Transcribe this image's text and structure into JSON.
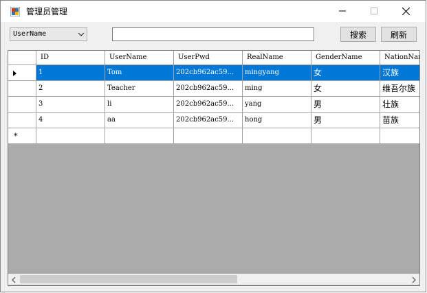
{
  "window": {
    "title": "管理员管理",
    "controls": [
      "minimize",
      "maximize",
      "close"
    ]
  },
  "toolbar": {
    "field_select": {
      "selected": "UserName"
    },
    "search_input": {
      "value": ""
    },
    "search_button_label": "搜索",
    "refresh_button_label": "刷新"
  },
  "grid": {
    "columns": [
      "ID",
      "UserName",
      "UserPwd",
      "RealName",
      "GenderName",
      "NationNam"
    ],
    "rows": [
      [
        "1",
        "Tom",
        "202cb962ac59...",
        "mingyang",
        "女",
        "汉族"
      ],
      [
        "2",
        "Teacher",
        "202cb962ac59...",
        "ming",
        "女",
        "维吾尔族"
      ],
      [
        "3",
        "li",
        "202cb962ac59...",
        "yang",
        "男",
        "壮族"
      ],
      [
        "4",
        "aa",
        "202cb962ac59...",
        "hong",
        "男",
        "苗族"
      ]
    ],
    "selected_row": 0,
    "new_row_marker": "*"
  },
  "colors": {
    "selection": "#0078d7",
    "grid_background": "#ababab",
    "window_background": "#f0f0f0"
  },
  "icons": {
    "app": "app-icon",
    "dropdown": "chevron-down-icon",
    "minimize": "minimize-icon",
    "maximize": "maximize-icon",
    "close": "close-icon",
    "row_pointer": "row-pointer-icon",
    "scroll_left": "chevron-left-icon",
    "scroll_right": "chevron-right-icon"
  }
}
